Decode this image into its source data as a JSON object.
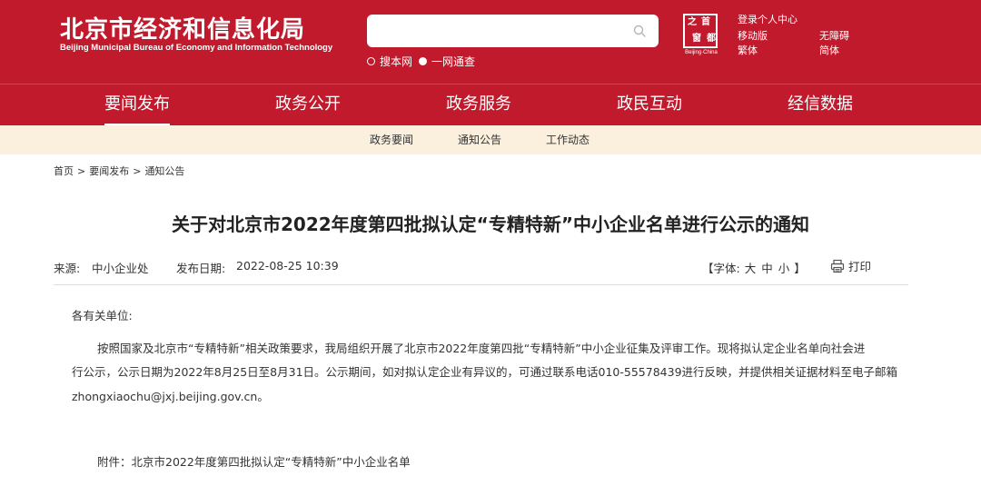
{
  "header": {
    "logo_cn": "北京市经济和信息化局",
    "logo_en": "Beijing Municipal Bureau of Economy and Information Technology",
    "search": {
      "placeholder": "",
      "value": ""
    },
    "scope_options": [
      "搜本网",
      "一网通查"
    ],
    "scope_selected": "一网通查",
    "seal_chars": [
      "首",
      "都",
      "之",
      "窗"
    ],
    "seal_caption": "Beijing·China",
    "links": {
      "login": "登录个人中心",
      "mobile": "移动版",
      "accessible": "无障碍",
      "traditional": "繁体",
      "simplified": "简体"
    }
  },
  "nav": {
    "items": [
      "要闻发布",
      "政务公开",
      "政务服务",
      "政民互动",
      "经信数据"
    ],
    "active": "要闻发布"
  },
  "subnav": {
    "items": [
      "政务要闻",
      "通知公告",
      "工作动态"
    ]
  },
  "breadcrumb": [
    "首页",
    "要闻发布",
    "通知公告"
  ],
  "breadcrumb_sep": ">",
  "article": {
    "title": "关于对北京市2022年度第四批拟认定“专精特新”中小企业名单进行公示的通知",
    "source_label": "来源:",
    "source": "中小企业处",
    "date_label": "发布日期:",
    "date": "2022-08-25 10:39",
    "font_label_open": "【字体:",
    "font_sizes": [
      "大",
      "中",
      "小"
    ],
    "font_label_close": "】",
    "print_label": "打印",
    "salutation": "各有关单位:",
    "body_lines": [
      "按照国家及北京市“专精特新”相关政策要求，我局组织开展了北京市2022年度第四批“专精特新”中小企业征集及评审工作。现将拟认定企业名单向社会进",
      "行公示，公示日期为2022年8月25日至8月31日。公示期间，如对拟认定企业有异议的，可通过联系电话010-55578439进行反映，并提供相关证据材料至电子邮箱",
      "zhongxiaochu@jxj.beijing.gov.cn。"
    ],
    "attachment": "附件：北京市2022年度第四批拟认定“专精特新”中小企业名单"
  },
  "colors": {
    "brand_red": "#c21a2d",
    "subnav_bg": "#fbf0dd",
    "text": "#333333"
  },
  "icons": [
    "search-icon",
    "print-icon"
  ]
}
